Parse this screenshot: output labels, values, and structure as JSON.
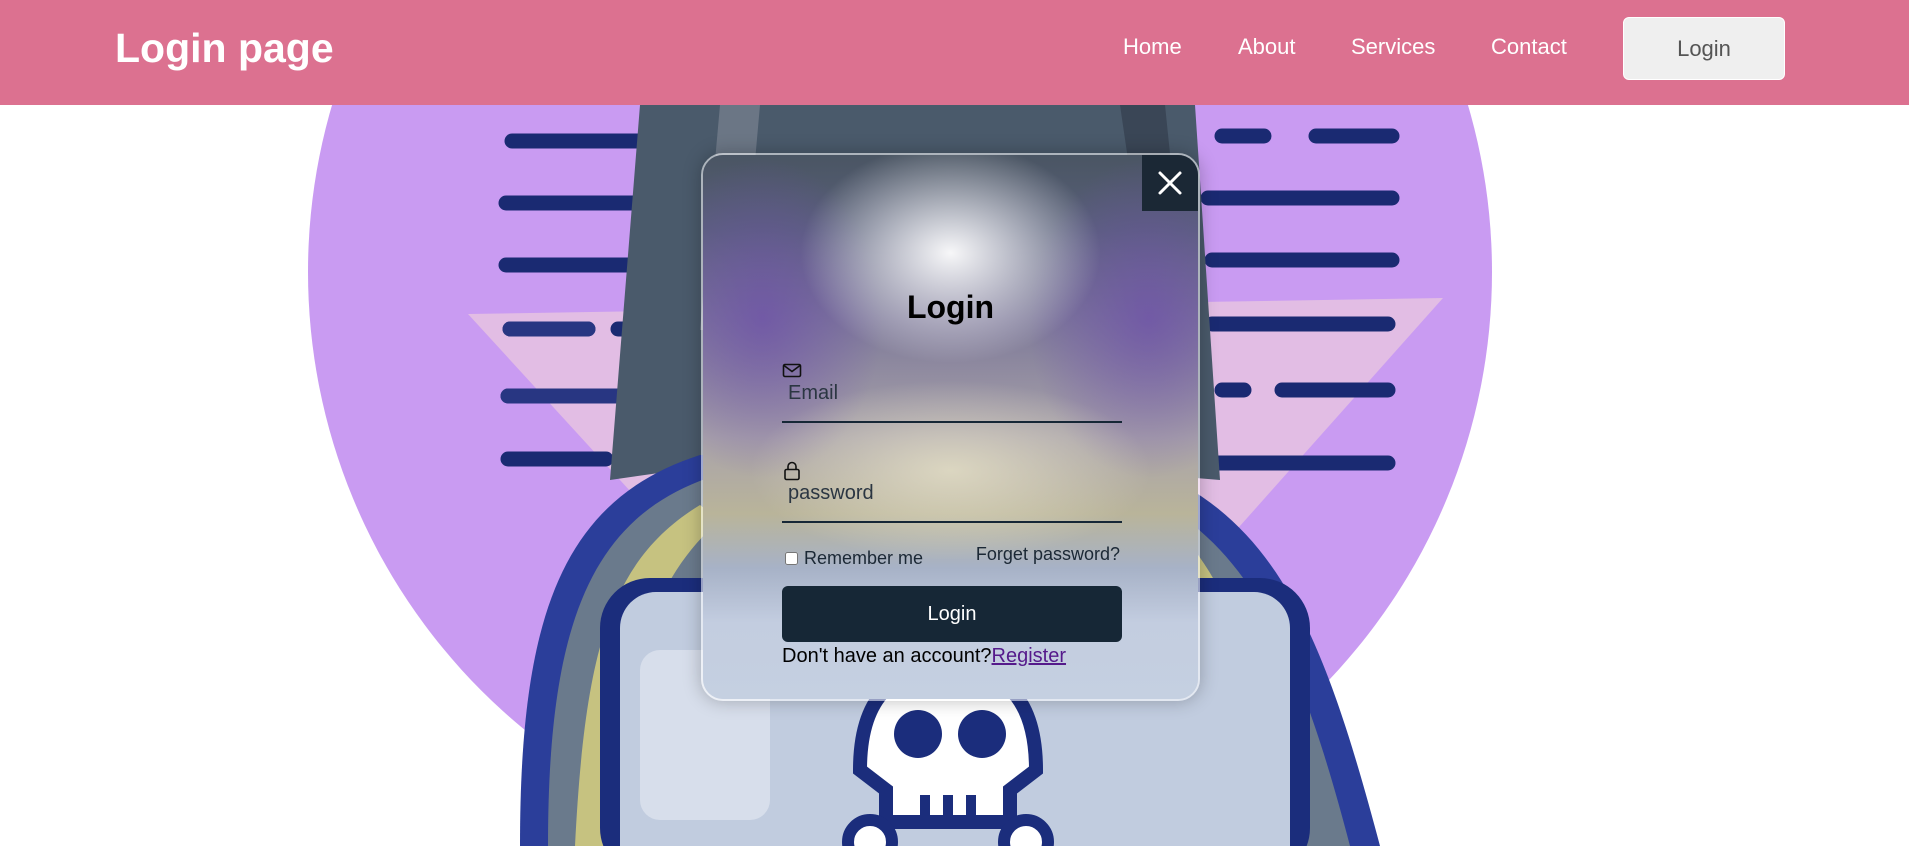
{
  "header": {
    "logo": "Login page",
    "background_color": "#dc7190",
    "nav": [
      {
        "label": "Home"
      },
      {
        "label": "About"
      },
      {
        "label": "Services"
      },
      {
        "label": "Contact"
      }
    ],
    "login_button": "Login"
  },
  "modal": {
    "title": "Login",
    "close_icon": "close-icon",
    "email": {
      "icon": "mail-icon",
      "placeholder": "Email",
      "value": ""
    },
    "password": {
      "icon": "lock-icon",
      "placeholder": "password",
      "value": ""
    },
    "remember_label": "Remember me",
    "remember_checked": false,
    "forgot_label": "Forget password?",
    "submit_label": "Login",
    "register_prompt": "Don't have an account?",
    "register_link": "Register",
    "accent_color": "#162736"
  },
  "background": {
    "illustration": "hacker-skull-laptop-illustration",
    "circle_color": "#c99bf2"
  }
}
